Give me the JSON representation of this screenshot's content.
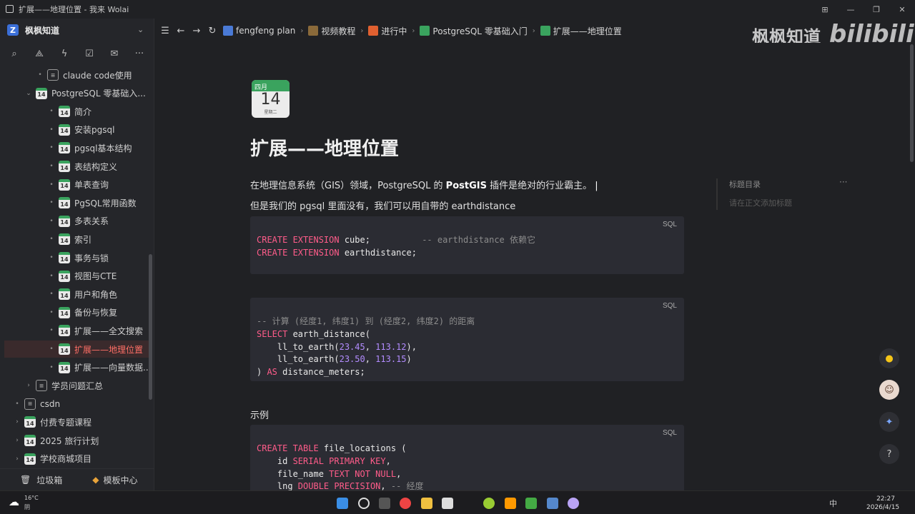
{
  "window": {
    "title": "扩展——地理位置 - 我来 Wolai"
  },
  "workspace": {
    "name": "枫枫知道"
  },
  "tree": [
    {
      "label": "claude code使用",
      "type": "page"
    },
    {
      "label": "PostgreSQL 零基础入...",
      "type": "cal"
    },
    {
      "label": "简介",
      "type": "cal"
    },
    {
      "label": "安装pgsql",
      "type": "cal"
    },
    {
      "label": "pgsql基本结构",
      "type": "cal"
    },
    {
      "label": "表结构定义",
      "type": "cal"
    },
    {
      "label": "单表查询",
      "type": "cal"
    },
    {
      "label": "PgSQL常用函数",
      "type": "cal"
    },
    {
      "label": "多表关系",
      "type": "cal"
    },
    {
      "label": "索引",
      "type": "cal"
    },
    {
      "label": "事务与锁",
      "type": "cal"
    },
    {
      "label": "视图与CTE",
      "type": "cal"
    },
    {
      "label": "用户和角色",
      "type": "cal"
    },
    {
      "label": "备份与恢复",
      "type": "cal"
    },
    {
      "label": "扩展——全文搜索",
      "type": "cal"
    },
    {
      "label": "扩展——地理位置",
      "type": "cal"
    },
    {
      "label": "扩展——向量数据...",
      "type": "cal"
    },
    {
      "label": "学员问题汇总",
      "type": "page"
    },
    {
      "label": "csdn",
      "type": "page"
    },
    {
      "label": "付费专题课程",
      "type": "cal"
    },
    {
      "label": "2025 旅行计划",
      "type": "cal"
    },
    {
      "label": "学校商城项目",
      "type": "cal"
    }
  ],
  "footer": {
    "trash": "垃圾箱",
    "templates": "模板中心"
  },
  "breadcrumbs": [
    "fengfeng plan",
    "视频教程",
    "进行中",
    "PostgreSQL 零基础入门",
    "扩展——地理位置"
  ],
  "watermark": {
    "text": "枫枫知道",
    "brand": "bilibili"
  },
  "calendar_icon": {
    "month": "四月",
    "day": "14",
    "weekday": "星期二"
  },
  "page": {
    "title": "扩展——地理位置",
    "p1_pre": "在地理信息系统（GIS）领域，PostgreSQL 的 ",
    "p1_bold": "PostGIS",
    "p1_post": " 插件是绝对的行业霸主。",
    "p2": "但是我们的 pgsql 里面没有，我们可以用自带的 earthdistance",
    "section_example": "示例"
  },
  "code_blocks": [
    {
      "lang": "SQL",
      "lines": [
        [
          [
            "kw",
            "CREATE EXTENSION"
          ],
          [
            "t",
            " cube;          "
          ],
          [
            "cm",
            "-- earthdistance 依赖它"
          ]
        ],
        [
          [
            "kw",
            "CREATE EXTENSION"
          ],
          [
            "t",
            " earthdistance;"
          ]
        ]
      ]
    },
    {
      "lang": "SQL",
      "lines": [
        [
          [
            "cm",
            "-- 计算 (经度1, 纬度1) 到 (经度2, 纬度2) 的距离"
          ]
        ],
        [
          [
            "kw",
            "SELECT"
          ],
          [
            "t",
            " earth_distance("
          ]
        ],
        [
          [
            "t",
            "    ll_to_earth("
          ],
          [
            "num",
            "23.45"
          ],
          [
            "t",
            ", "
          ],
          [
            "num",
            "113.12"
          ],
          [
            "t",
            "),"
          ]
        ],
        [
          [
            "t",
            "    ll_to_earth("
          ],
          [
            "num",
            "23.50"
          ],
          [
            "t",
            ", "
          ],
          [
            "num",
            "113.15"
          ],
          [
            "t",
            ")"
          ]
        ],
        [
          [
            "t",
            ") "
          ],
          [
            "kw",
            "AS"
          ],
          [
            "t",
            " distance_meters;"
          ]
        ]
      ]
    },
    {
      "lang": "SQL",
      "lines": [
        [
          [
            "kw",
            "CREATE TABLE"
          ],
          [
            "t",
            " file_locations ("
          ]
        ],
        [
          [
            "t",
            "    id "
          ],
          [
            "kw",
            "SERIAL PRIMARY KEY"
          ],
          [
            "t",
            ","
          ]
        ],
        [
          [
            "t",
            "    file_name "
          ],
          [
            "kw",
            "TEXT NOT NULL"
          ],
          [
            "t",
            ","
          ]
        ],
        [
          [
            "t",
            "    lng "
          ],
          [
            "kw",
            "DOUBLE PRECISION"
          ],
          [
            "t",
            ", "
          ],
          [
            "cm",
            "-- 经度"
          ]
        ]
      ]
    }
  ],
  "toc": {
    "title": "标题目录",
    "empty": "请在正文添加标题",
    "more": "···"
  },
  "taskbar": {
    "weather_temp": "16°C",
    "weather_desc": "阴",
    "time": "22:27",
    "date": "2026/4/15",
    "ime": "中"
  }
}
